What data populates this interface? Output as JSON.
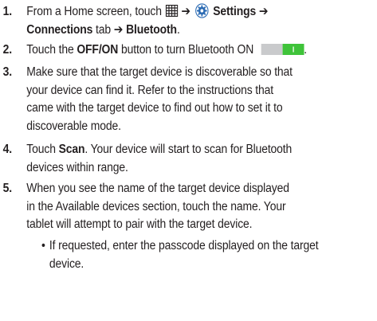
{
  "steps": [
    {
      "number": "1.",
      "line1_prefix": "From a Home screen, touch",
      "arrow1": "➔",
      "settings_label": "Settings ➔",
      "connections_label": "Connections",
      "tab_text": " tab ",
      "arrow2": "➔",
      "bluetooth_label": " Bluetooth",
      "period": "."
    },
    {
      "number": "2.",
      "text_prefix": "Touch the ",
      "offon_label": "OFF/ON",
      "text_suffix": " button to turn Bluetooth ON",
      "period": "."
    },
    {
      "number": "3.",
      "lines": [
        "Make sure that the target device is discoverable so that",
        "your device can find it. Refer to the instructions that",
        "came with the target device to find out how to set it to",
        "discoverable mode."
      ]
    },
    {
      "number": "4.",
      "text_prefix": "Touch ",
      "scan_label": "Scan",
      "text_suffix": ". Your device will start to scan for Bluetooth",
      "line2": "devices within range."
    },
    {
      "number": "5.",
      "lines": [
        "When you see the name of the target device displayed",
        "in the Available devices section, touch the name. Your",
        "tablet will attempt to pair with the target device."
      ]
    }
  ],
  "bullet": {
    "dot": "•",
    "lines": [
      "If requested, enter the passcode displayed on the target",
      "device."
    ]
  },
  "colors": {
    "toggle_green": "#3fc33a",
    "toggle_gray": "#c9cacc",
    "gear_blue": "#2a6ab3"
  },
  "icons": {
    "apps": "apps-grid-icon",
    "settings": "settings-gear-icon",
    "toggle": "toggle-on-icon"
  }
}
